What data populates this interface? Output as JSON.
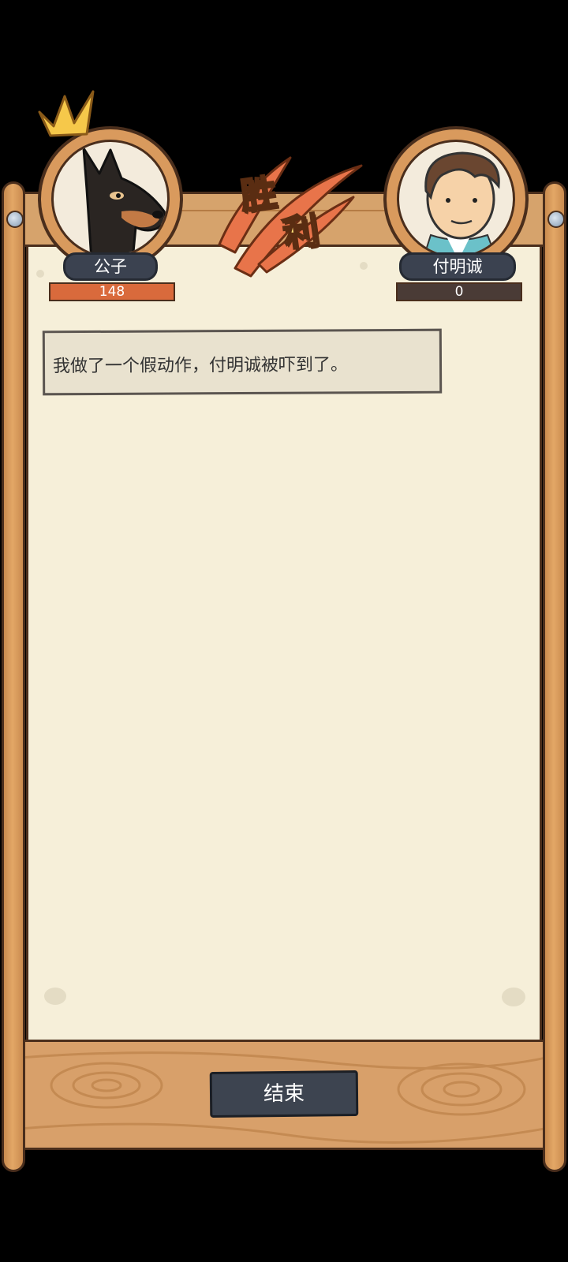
{
  "header": {
    "victory_text_1": "胜",
    "victory_text_2": "利"
  },
  "players": {
    "left": {
      "name": "公子",
      "score": "148",
      "avatar_icon": "doberman-dog-avatar",
      "badge_icon": "crown-icon"
    },
    "right": {
      "name": "付明诚",
      "score": "0",
      "avatar_icon": "young-man-avatar"
    }
  },
  "log": {
    "message": "我做了一个假动作，付明诚被吓到了。"
  },
  "footer": {
    "end_label": "结束"
  },
  "colors": {
    "wood": "#d6a36c",
    "parchment": "#f6efd9",
    "left_score": "#d96a3c",
    "right_score": "#4a3b36",
    "button": "#3d4450"
  }
}
